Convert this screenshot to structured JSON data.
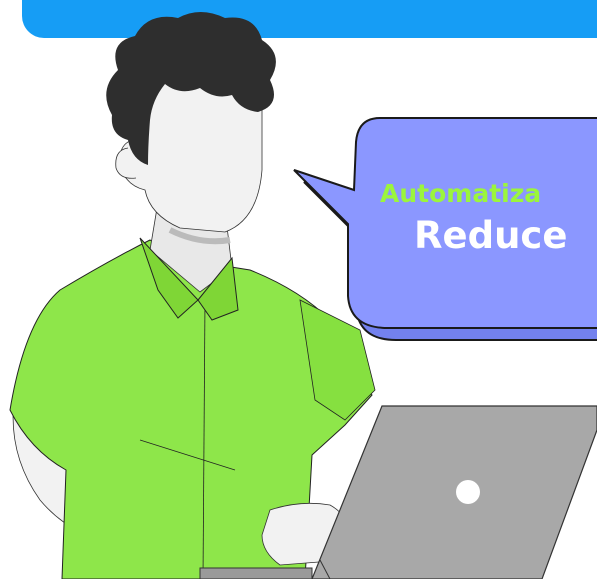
{
  "banner": {
    "color": "#169df5"
  },
  "speech_bubble": {
    "line_1": "Automatiza",
    "line_2": "Reduce",
    "fill_color": "#8b97ff",
    "line_1_color": "#9bf53d",
    "line_2_color": "#ffffff"
  },
  "illustration": {
    "person_shirt_color": "#8ee64a",
    "hair_color": "#2e2e2e",
    "laptop_color": "#a8a8a8",
    "icons": [
      "person-illustration",
      "laptop-icon",
      "speech-bubble"
    ]
  }
}
